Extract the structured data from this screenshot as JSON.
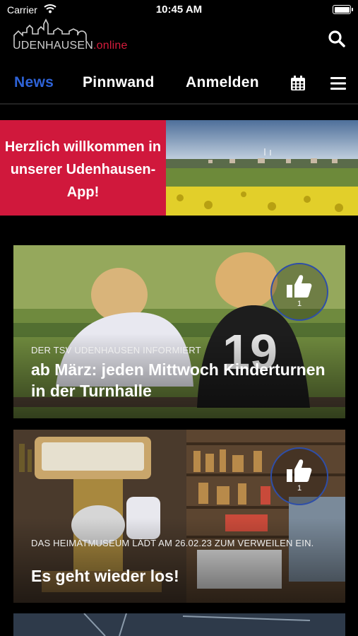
{
  "status_bar": {
    "carrier": "Carrier",
    "time": "10:45 AM"
  },
  "header": {
    "logo_part1": "UDENHAUSEN",
    "logo_part2": ".online",
    "search_icon": "search-icon"
  },
  "nav": {
    "tabs": [
      {
        "label": "News",
        "active": true
      },
      {
        "label": "Pinnwand",
        "active": false
      },
      {
        "label": "Anmelden",
        "active": false
      }
    ],
    "calendar_icon": "calendar-icon",
    "menu_icon": "hamburger-menu-icon",
    "active_color": "#2e63d8"
  },
  "banner": {
    "text": "Herzlich willkommen in unserer Udenhausen-App!",
    "color": "#d0183c"
  },
  "news": [
    {
      "kicker": "DER TSV UDENHAUSEN INFORMIERT",
      "headline": "ab März: jeden Mittwoch Kinderturnen in der Turnhalle",
      "likes": "1"
    },
    {
      "kicker": "DAS HEIMATMUSEUM LÄDT AM 26.02.23 ZUM VERWEILEN EIN.",
      "headline": "Es geht wieder los!",
      "likes": "1"
    }
  ]
}
